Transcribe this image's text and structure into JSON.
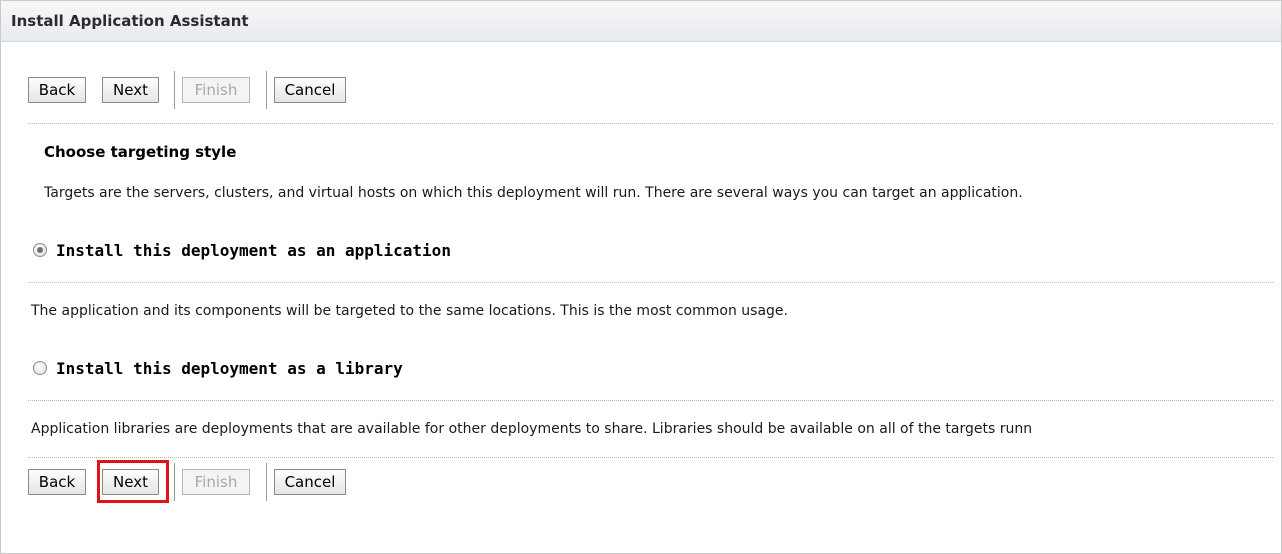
{
  "header": {
    "title": "Install Application Assistant"
  },
  "toolbar_top": {
    "back": "Back",
    "next": "Next",
    "finish": "Finish",
    "cancel": "Cancel"
  },
  "toolbar_bottom": {
    "back": "Back",
    "next": "Next",
    "finish": "Finish",
    "cancel": "Cancel"
  },
  "section": {
    "heading": "Choose targeting style",
    "description": "Targets are the servers, clusters, and virtual hosts on which this deployment will run. There are several ways you can target an application."
  },
  "options": [
    {
      "label": "Install this deployment as an application",
      "selected": true,
      "description": "The application and its components will be targeted to the same locations. This is the most common usage."
    },
    {
      "label": "Install this deployment as a library",
      "selected": false,
      "description": "Application libraries are deployments that are available for other deployments to share. Libraries should be available on all of the targets runn"
    }
  ],
  "colors": {
    "highlight": "#e0121b",
    "header_bg": "#eef0f2",
    "disabled_text": "#a8a8a8"
  }
}
